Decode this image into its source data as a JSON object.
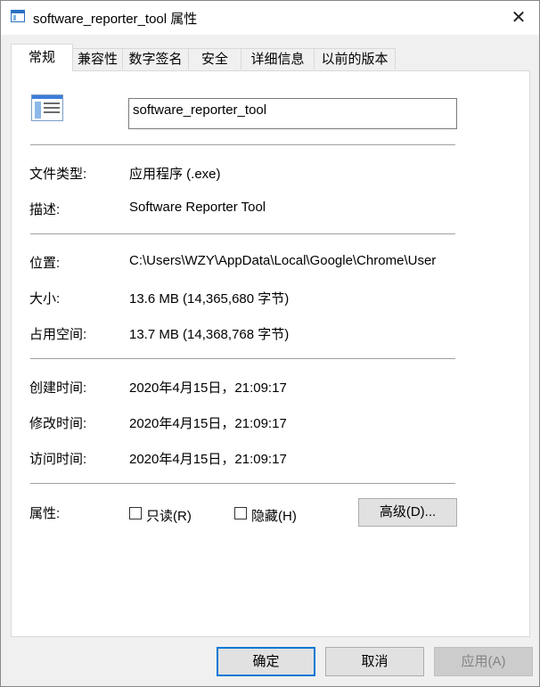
{
  "window": {
    "title": "software_reporter_tool 属性",
    "close_glyph": "✕"
  },
  "tabs": [
    {
      "label": "常规",
      "active": true
    },
    {
      "label": "兼容性",
      "active": false
    },
    {
      "label": "数字签名",
      "active": false
    },
    {
      "label": "安全",
      "active": false
    },
    {
      "label": "详细信息",
      "active": false
    },
    {
      "label": "以前的版本",
      "active": false
    }
  ],
  "general": {
    "file_name": "software_reporter_tool",
    "file_type": {
      "label": "文件类型:",
      "value": "应用程序 (.exe)"
    },
    "description": {
      "label": "描述:",
      "value": "Software Reporter Tool"
    },
    "location": {
      "label": "位置:",
      "value": "C:\\Users\\WZY\\AppData\\Local\\Google\\Chrome\\User"
    },
    "size": {
      "label": "大小:",
      "value": "13.6 MB (14,365,680 字节)"
    },
    "size_on_disk": {
      "label": "占用空间:",
      "value": "13.7 MB (14,368,768 字节)"
    },
    "created": {
      "label": "创建时间:",
      "value": "2020年4月15日，21:09:17"
    },
    "modified": {
      "label": "修改时间:",
      "value": "2020年4月15日，21:09:17"
    },
    "accessed": {
      "label": "访问时间:",
      "value": "2020年4月15日，21:09:17"
    },
    "attributes": {
      "label": "属性:",
      "readonly": {
        "label": "只读(R)",
        "checked": false
      },
      "hidden": {
        "label": "隐藏(H)",
        "checked": false
      },
      "advanced_button": "高级(D)..."
    }
  },
  "footer": {
    "ok": "确定",
    "cancel": "取消",
    "apply": "应用(A)"
  }
}
